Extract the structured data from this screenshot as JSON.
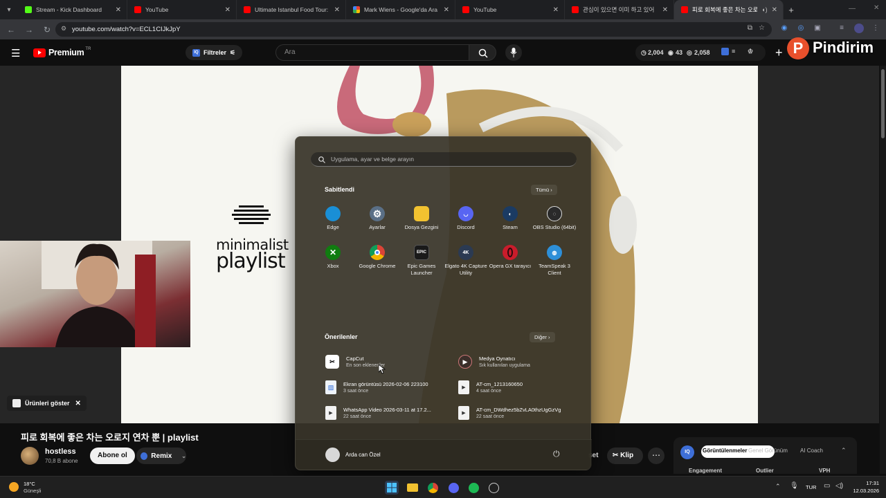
{
  "browser": {
    "tabs": [
      {
        "title": "Stream - Kick Dashboard",
        "favicon": "kick-icon"
      },
      {
        "title": "YouTube",
        "favicon": "youtube-icon"
      },
      {
        "title": "Ultimate Istanbul Food Tour: Be",
        "favicon": "youtube-icon"
      },
      {
        "title": "Mark Wiens - Google'da Ara",
        "favicon": "google-icon"
      },
      {
        "title": "YouTube",
        "favicon": "youtube-icon"
      },
      {
        "title": "관심이 있으면 이미 하고 있어",
        "favicon": "youtube-icon"
      },
      {
        "title": "피로 회복에 좋은 차는 오로",
        "favicon": "youtube-icon",
        "active": true
      }
    ],
    "url": "youtube.com/watch?v=ECL1CIJkJpY"
  },
  "youtube_header": {
    "logo_text": "Premium",
    "region": "TR",
    "filter_label": "Filtreler",
    "search_placeholder": "Ara",
    "stats": {
      "views": "2,004",
      "likes": "43",
      "comments": "2,058"
    },
    "brand_overlay": "Pindirim"
  },
  "video": {
    "overlay_line1": "minimalist",
    "overlay_line2": "playlist",
    "title": "피로 회복에 좋은 차는 오로지 연차 뿐 | playlist",
    "channel": "hostless",
    "subscribers": "70,8 B abone",
    "subscribe_label": "Abone ol",
    "remix_label": "Remix",
    "products_label": "Ürünleri göster",
    "clip_label": "Klip",
    "share_partial": "şet"
  },
  "right_panel": {
    "tabs": [
      "Görüntülenmeler",
      "Genel Görünüm",
      "AI Coach"
    ],
    "columns": [
      "Engagement",
      "Outlier",
      "VPH"
    ]
  },
  "start_menu": {
    "search_placeholder": "Uygulama, ayar ve belge arayın",
    "pinned_header": "Sabitlendi",
    "pinned_more": "Tümü",
    "pinned": [
      {
        "label": "Edge",
        "icon": "edge-icon",
        "color": "#1a8fd6"
      },
      {
        "label": "Ayarlar",
        "icon": "settings-icon",
        "color": "#5a6f86"
      },
      {
        "label": "Dosya Gezgini",
        "icon": "folder-icon",
        "color": "#f2c230"
      },
      {
        "label": "Discord",
        "icon": "discord-icon",
        "color": "#5865f2"
      },
      {
        "label": "Steam",
        "icon": "steam-icon",
        "color": "#1b3b63"
      },
      {
        "label": "OBS Studio (64bit)",
        "icon": "obs-icon",
        "color": "#2a2a2a"
      },
      {
        "label": "Xbox",
        "icon": "xbox-icon",
        "color": "#107c10"
      },
      {
        "label": "Google Chrome",
        "icon": "chrome-icon",
        "color": "#db4437"
      },
      {
        "label": "Epic Games Launcher",
        "icon": "epic-icon",
        "color": "#1a1a1a"
      },
      {
        "label": "Elgato 4K Capture Utility",
        "icon": "elgato-icon",
        "color": "#2b3a52"
      },
      {
        "label": "Opera GX tarayıcı",
        "icon": "opera-icon",
        "color": "#c91c2b"
      },
      {
        "label": "TeamSpeak 3 Client",
        "icon": "teamspeak-icon",
        "color": "#2d8fd8"
      }
    ],
    "recommended_header": "Önerilenler",
    "recommended_more": "Diğer",
    "recommended": [
      {
        "name": "CapCut",
        "sub": "En son eklenenler",
        "icon": "capcut-icon"
      },
      {
        "name": "Medya Oynatıcı",
        "sub": "Sık kullanılan uygulama",
        "icon": "media-player-icon"
      },
      {
        "name": "Ekran görüntüsü 2026-02-06 223100",
        "sub": "3 saat önce",
        "icon": "image-file-icon"
      },
      {
        "name": "AT-cm_1213160650",
        "sub": "4 saat önce",
        "icon": "video-file-icon"
      },
      {
        "name": "WhatsApp Video 2026-03-11 at 17.2...",
        "sub": "22 saat önce",
        "icon": "video-file-icon"
      },
      {
        "name": "AT-cm_DWdhez5bZvLA0thzUgGzVg",
        "sub": "22 saat önce",
        "icon": "video-file-icon"
      }
    ],
    "user_name": "Arda can Özel"
  },
  "taskbar": {
    "weather_temp": "18°C",
    "weather_desc": "Güneşli",
    "language": "TUR",
    "time": "17:31",
    "date": "12.03.2026"
  }
}
